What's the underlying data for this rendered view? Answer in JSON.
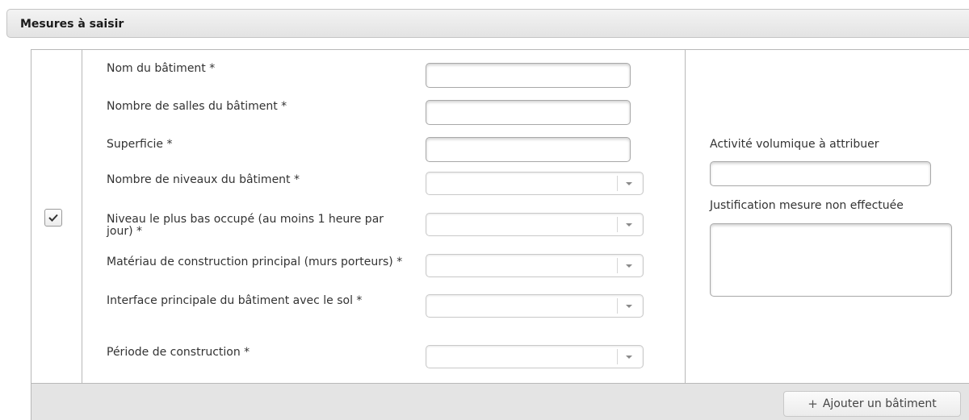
{
  "panel": {
    "title": "Mesures à saisir"
  },
  "row": {
    "checked": true
  },
  "fields": [
    {
      "label": "Nom du bâtiment  *",
      "type": "text",
      "value": ""
    },
    {
      "label": "Nombre de salles du bâtiment  *",
      "type": "text",
      "value": ""
    },
    {
      "label": "Superficie  *",
      "type": "text",
      "value": ""
    },
    {
      "label": "Nombre de niveaux du bâtiment  *",
      "type": "select",
      "value": ""
    },
    {
      "label": "Niveau le plus bas occupé (au moins 1 heure par jour)  *",
      "type": "select",
      "value": ""
    },
    {
      "label": "Matériau de construction principal (murs porteurs)  *",
      "type": "select",
      "value": ""
    },
    {
      "label": "Interface principale du bâtiment avec le sol  *",
      "type": "select",
      "value": ""
    },
    {
      "label": "Période de construction  *",
      "type": "select",
      "value": ""
    }
  ],
  "side": {
    "activite_label": "Activité volumique à attribuer",
    "activite_value": "",
    "justification_label": "Justification mesure non effectuée",
    "justification_value": ""
  },
  "footer": {
    "add_button_label": "Ajouter un bâtiment",
    "add_icon": "plus-icon"
  }
}
